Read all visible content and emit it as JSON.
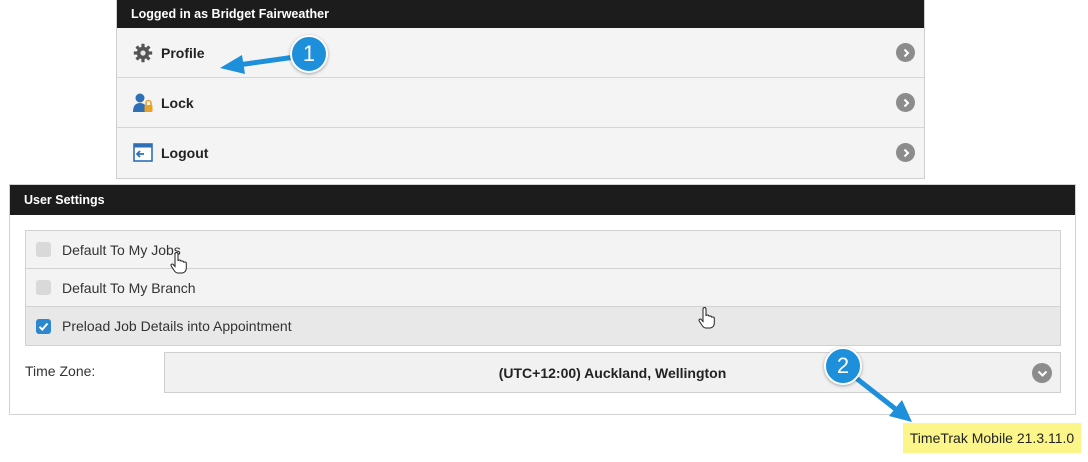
{
  "user_menu": {
    "header": "Logged in as Bridget Fairweather",
    "items": [
      {
        "label": "Profile",
        "icon": "gear-icon"
      },
      {
        "label": "Lock",
        "icon": "user-lock-icon"
      },
      {
        "label": "Logout",
        "icon": "logout-icon"
      }
    ]
  },
  "user_settings": {
    "header": "User Settings",
    "options": [
      {
        "label": "Default To My Jobs",
        "checked": false
      },
      {
        "label": "Default To My Branch",
        "checked": false
      },
      {
        "label": "Preload Job Details into Appointment",
        "checked": true
      }
    ],
    "time_zone": {
      "label": "Time Zone:",
      "value": "(UTC+12:00) Auckland, Wellington"
    }
  },
  "version": "TimeTrak Mobile 21.3.11.0",
  "callouts": [
    "1",
    "2"
  ],
  "colors": {
    "header_bg": "#1c1c1c",
    "accent_blue": "#1d8fdb",
    "checkbox_checked": "#2a87d0",
    "version_highlight": "#fbf58a"
  }
}
